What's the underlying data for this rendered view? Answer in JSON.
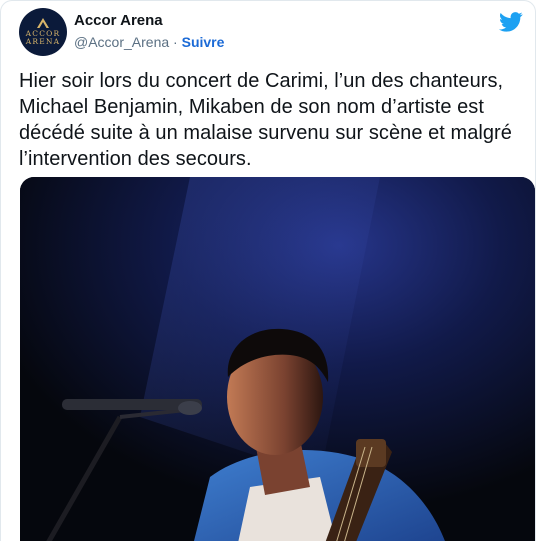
{
  "tweet": {
    "author": {
      "display_name": "Accor Arena",
      "handle": "@Accor_Arena",
      "separator": "·",
      "follow_label": "Suivre",
      "avatar_text_line1": "ACCOR",
      "avatar_text_line2": "ARENA"
    },
    "body": "Hier soir lors du concert de Carimi, l’un des chanteurs, Michael Benjamin, Mikaben de son nom d’artiste est décédé suite à un malaise survenu sur scène et malgré l’intervention des secours.",
    "icons": {
      "brand": "twitter-bird-icon"
    },
    "colors": {
      "twitter_blue": "#1da1f2",
      "follow_link": "#1b6ad6",
      "muted_text": "#5b7083",
      "avatar_bg": "#0b1a3a",
      "avatar_gold": "#d8b56a"
    }
  }
}
